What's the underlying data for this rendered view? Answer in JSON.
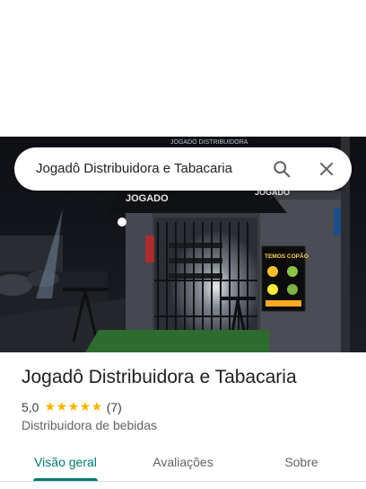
{
  "search": {
    "query": "Jogadô Distribuidora e Tabacaria",
    "search_icon": "search-icon",
    "close_icon": "close-icon"
  },
  "photo": {
    "sign_text": "JOGADO",
    "sign_text_right": "JOGADO",
    "poster_title": "TEMOS COPÃO",
    "banner_text": "JOGADO DISTRIBUIDORA"
  },
  "place": {
    "name": "Jogadô Distribuidora e Tabacaria",
    "rating": "5,0",
    "stars": "★★★★★",
    "review_count": "(7)",
    "category": "Distribuidora de bebidas"
  },
  "tabs": [
    {
      "label": "Visão geral",
      "active": true
    },
    {
      "label": "Avaliações",
      "active": false
    },
    {
      "label": "Sobre",
      "active": false
    }
  ],
  "colors": {
    "accent": "#00796b",
    "star": "#f4b400",
    "text": "#202124"
  }
}
